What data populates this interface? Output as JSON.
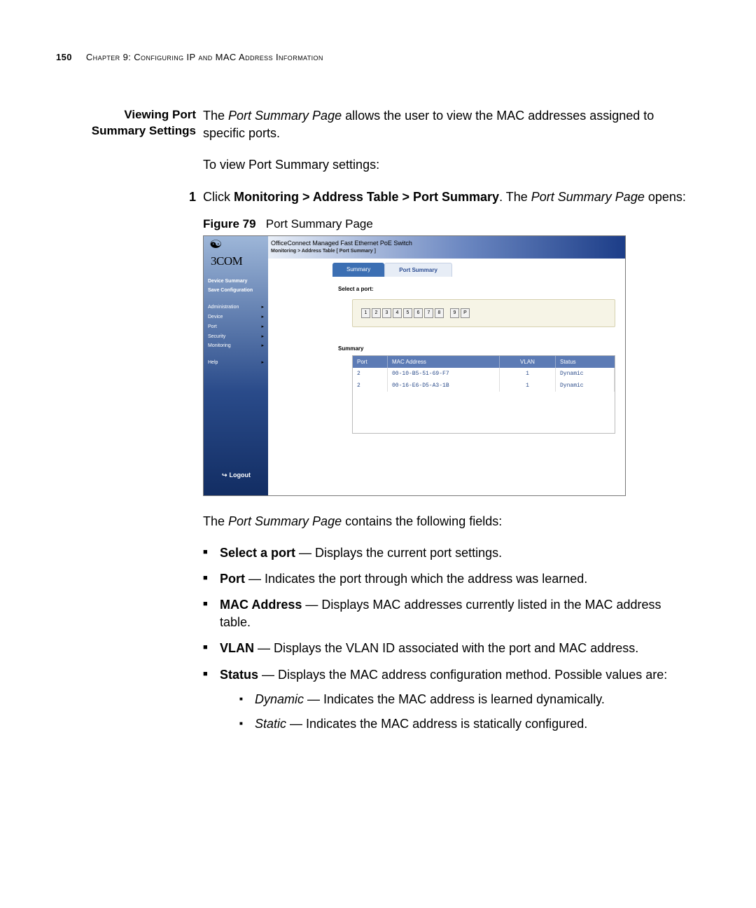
{
  "page_number": "150",
  "chapter_line": "Chapter 9: Configuring IP and MAC Address Information",
  "section_heading_l1": "Viewing Port",
  "section_heading_l2": "Summary Settings",
  "intro_para_pre": "The ",
  "intro_para_em": "Port Summary Page",
  "intro_para_post": " allows the user to view the MAC addresses assigned to specific ports.",
  "howto_line": "To view Port Summary settings:",
  "step1_num": "1",
  "step1_pre": "Click ",
  "step1_bold": "Monitoring > Address Table > Port Summary",
  "step1_mid": ". The ",
  "step1_em": "Port Summary Page",
  "step1_post": " opens:",
  "figure_label": "Figure 79",
  "figure_title": "Port Summary Page",
  "screenshot": {
    "logo_text": "3COM",
    "header_title": "OfficeConnect Managed Fast Ethernet PoE Switch",
    "breadcrumb": "Monitoring > Address Table [ Port Summary ]",
    "tabs": {
      "inactive": "Summary",
      "active": "Port Summary"
    },
    "nav": {
      "device_summary": "Device Summary",
      "save_config": "Save Configuration",
      "administration": "Administration",
      "device": "Device",
      "port": "Port",
      "security": "Security",
      "monitoring": "Monitoring",
      "help": "Help"
    },
    "logout": "Logout",
    "select_label": "Select a port:",
    "ports": [
      "1",
      "2",
      "3",
      "4",
      "5",
      "6",
      "7",
      "8",
      "9",
      "P"
    ],
    "summary_label": "Summary",
    "table": {
      "headers": {
        "port": "Port",
        "mac": "MAC Address",
        "vlan": "VLAN",
        "status": "Status"
      },
      "rows": [
        {
          "port": "2",
          "mac": "00-10-B5-51-69-F7",
          "vlan": "1",
          "status": "Dynamic"
        },
        {
          "port": "2",
          "mac": "00-16-E6-D5-A3-1B",
          "vlan": "1",
          "status": "Dynamic"
        }
      ]
    }
  },
  "after_intro_pre": "The ",
  "after_intro_em": "Port Summary Page",
  "after_intro_post": " contains the following fields:",
  "bullets": {
    "select": {
      "b": "Select a port",
      "t": " — Displays the current port settings."
    },
    "port": {
      "b": "Port",
      "t": " — Indicates the port through which the address was learned."
    },
    "mac": {
      "b": "MAC Address",
      "t": " — Displays MAC addresses currently listed in the MAC address table."
    },
    "vlan": {
      "b": "VLAN",
      "t": " — Displays the VLAN ID associated with the port and MAC address."
    },
    "status": {
      "b": "Status",
      "t": " — Displays the MAC address configuration method. Possible values are:"
    }
  },
  "sub": {
    "dynamic": {
      "i": "Dynamic",
      "t": " — Indicates the MAC address is learned dynamically."
    },
    "static": {
      "i": "Static",
      "t": " — Indicates the MAC address is statically configured."
    }
  }
}
